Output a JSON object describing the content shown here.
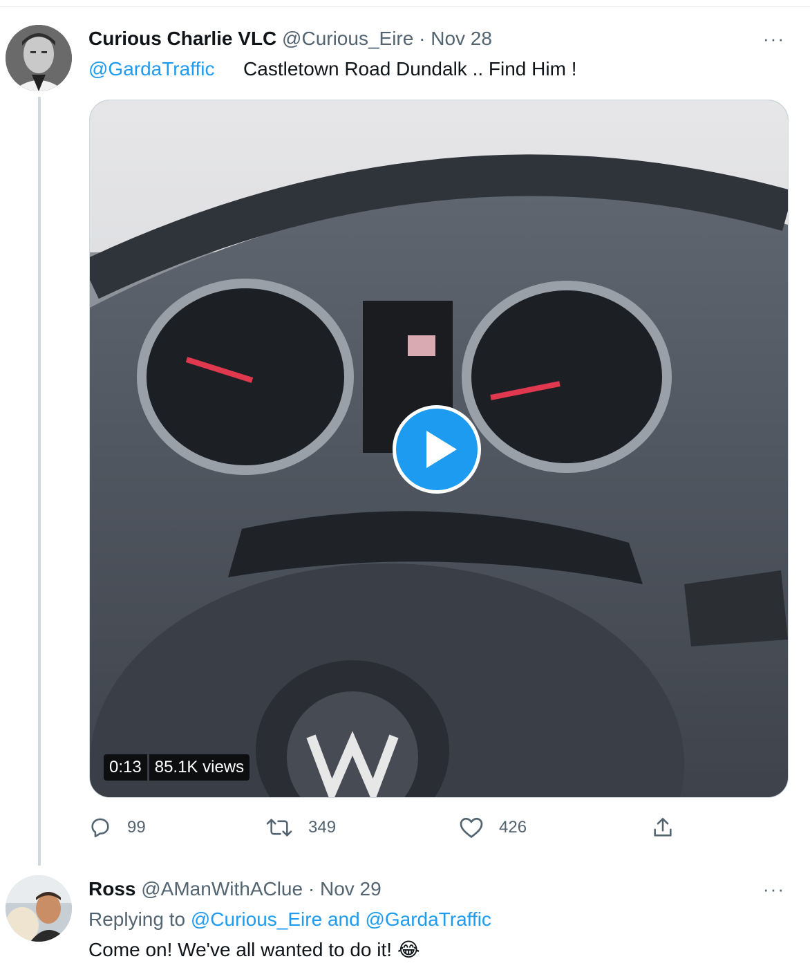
{
  "tweet": {
    "display_name": "Curious Charlie VLC",
    "handle": "@Curious_Eire",
    "separator": "·",
    "date": "Nov 28",
    "more_label": "···",
    "mention": "@GardaTraffic",
    "text": "Castletown Road Dundalk ..  Find Him !",
    "video": {
      "duration": "0:13",
      "views": "85.1K views"
    },
    "actions": {
      "replies": "99",
      "retweets": "349",
      "likes": "426"
    }
  },
  "reply": {
    "display_name": "Ross",
    "handle": "@AManWithAClue",
    "separator": "·",
    "date": "Nov 29",
    "more_label": "···",
    "replying_to_prefix": "Replying to",
    "replying_to_user1": "@Curious_Eire",
    "replying_and": "and",
    "replying_to_user2": "@GardaTraffic",
    "text": "Come on! We've all wanted to do it!",
    "emoji": "😂"
  },
  "colors": {
    "accent": "#1d9bf0",
    "muted": "#536471",
    "text": "#0f1419"
  }
}
